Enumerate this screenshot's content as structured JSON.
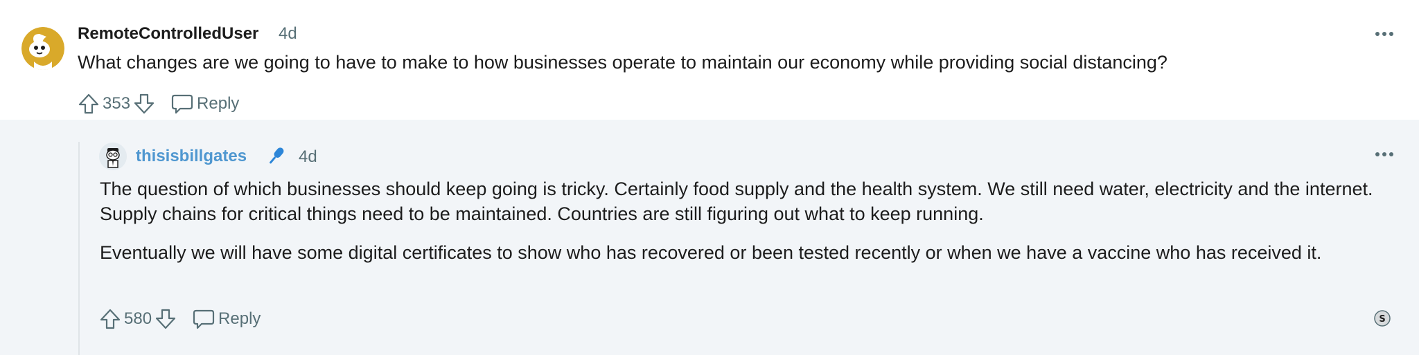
{
  "parent_comment": {
    "username": "RemoteControlledUser",
    "timestamp": "4d",
    "body": "What changes are we going to have to make to how businesses operate to maintain our economy while providing social distancing?",
    "score": "353",
    "reply_label": "Reply"
  },
  "child_comment": {
    "username": "thisisbillgates",
    "flair_icon": "microphone-icon",
    "timestamp": "4d",
    "paragraphs": [
      "The question of which businesses should keep going is tricky. Certainly food supply and the health system. We still need water, electricity and the internet. Supply chains for critical things need to be maintained. Countries are still figuring out what to keep running.",
      "Eventually we will have some digital certificates to show who has recovered or been tested recently or when we have a vaccine who has received it."
    ],
    "score": "580",
    "reply_label": "Reply"
  },
  "colors": {
    "username_link": "#4f97d0",
    "meta_gray": "#576f76",
    "thread_background": "#f2f5f8"
  }
}
